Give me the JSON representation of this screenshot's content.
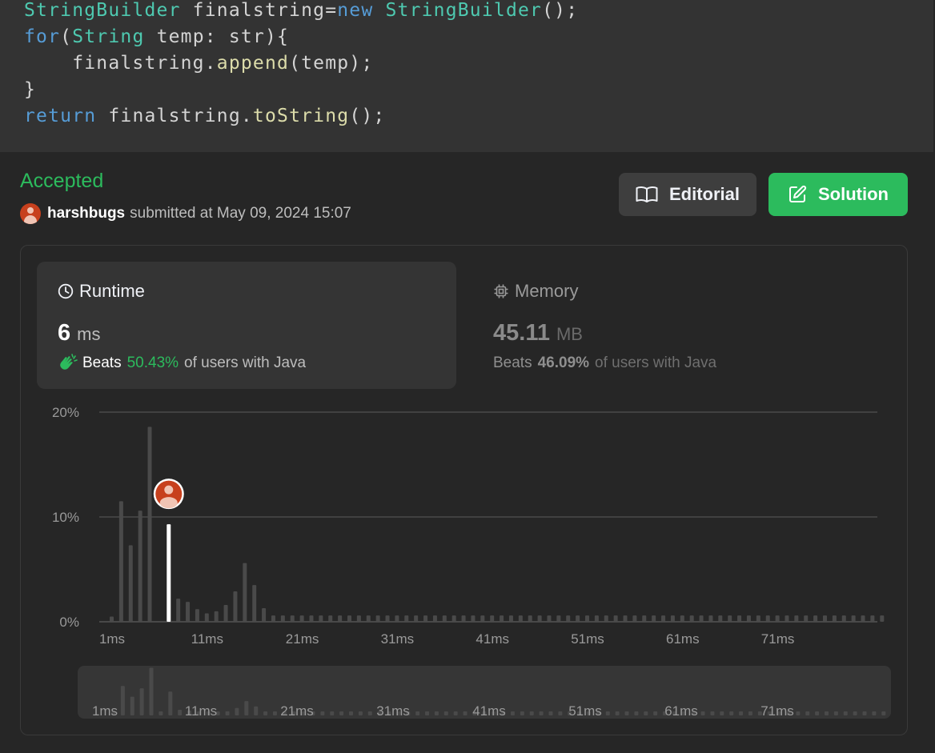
{
  "code": {
    "lines": [
      [
        {
          "t": "StringBuilder",
          "c": "ty"
        },
        {
          "t": " finalstring=",
          "c": "pl"
        },
        {
          "t": "new",
          "c": "kw"
        },
        {
          "t": " ",
          "c": "pl"
        },
        {
          "t": "StringBuilder",
          "c": "ty"
        },
        {
          "t": "();",
          "c": "pl"
        }
      ],
      [
        {
          "t": "for",
          "c": "kw"
        },
        {
          "t": "(",
          "c": "pl"
        },
        {
          "t": "String",
          "c": "ty"
        },
        {
          "t": " temp: str){",
          "c": "pl"
        }
      ],
      [
        {
          "t": "    finalstring.",
          "c": "pl"
        },
        {
          "t": "append",
          "c": "fn"
        },
        {
          "t": "(temp);",
          "c": "pl"
        }
      ],
      [
        {
          "t": "}",
          "c": "pl"
        }
      ],
      [
        {
          "t": "return",
          "c": "kw"
        },
        {
          "t": " finalstring.",
          "c": "pl"
        },
        {
          "t": "toString",
          "c": "fn"
        },
        {
          "t": "();",
          "c": "pl"
        }
      ]
    ]
  },
  "submission": {
    "status": "Accepted",
    "username": "harshbugs",
    "submitted_text": "submitted at May 09, 2024 15:07"
  },
  "buttons": {
    "editorial": "Editorial",
    "solution": "Solution"
  },
  "runtime": {
    "title": "Runtime",
    "value": "6",
    "unit": "ms",
    "beats_word": "Beats",
    "beats_pct": "50.43%",
    "beats_suffix": "of users with Java"
  },
  "memory": {
    "title": "Memory",
    "value": "45.11",
    "unit": "MB",
    "beats_word": "Beats",
    "beats_pct": "46.09%",
    "beats_suffix": "of users with Java"
  },
  "colors": {
    "accent_green": "#2cbb5d",
    "highlight_bar": "#ffffff",
    "bar": "#4a4a4a"
  },
  "chart_data": {
    "type": "bar",
    "y_ticks": [
      "20%",
      "10%",
      "0%"
    ],
    "ylim": [
      0,
      20
    ],
    "x_tick_labels": [
      "1ms",
      "11ms",
      "21ms",
      "31ms",
      "41ms",
      "51ms",
      "61ms",
      "71ms"
    ],
    "x_start": 0,
    "highlight_x": 6,
    "values": [
      0.5,
      11.5,
      7.3,
      10.6,
      18.6,
      0,
      9.3,
      2.2,
      1.9,
      1.2,
      0.8,
      1.0,
      1.6,
      2.9,
      5.6,
      3.5,
      1.3,
      0.6,
      0.6,
      0.6,
      0.6,
      0.6,
      0.6,
      0.6,
      0.6,
      0.6,
      0.6,
      0.6,
      0.6,
      0.6,
      0.6,
      0.6,
      0.6,
      0.6,
      0.6,
      0.6,
      0.6,
      0.6,
      0.6,
      0.6,
      0.6,
      0.6,
      0.6,
      0.6,
      0.6,
      0.6,
      0.6,
      0.6,
      0.6,
      0.6,
      0.6,
      0.6,
      0.6,
      0.6,
      0.6,
      0.6,
      0.6,
      0.6,
      0.6,
      0.6,
      0.6,
      0.6,
      0.6,
      0.6,
      0.6,
      0.6,
      0.6,
      0.6,
      0.6,
      0.6,
      0.6,
      0.6,
      0.6,
      0.6,
      0.6,
      0.6,
      0.6,
      0.6,
      0.6,
      0.6,
      0.6,
      0.6
    ]
  }
}
